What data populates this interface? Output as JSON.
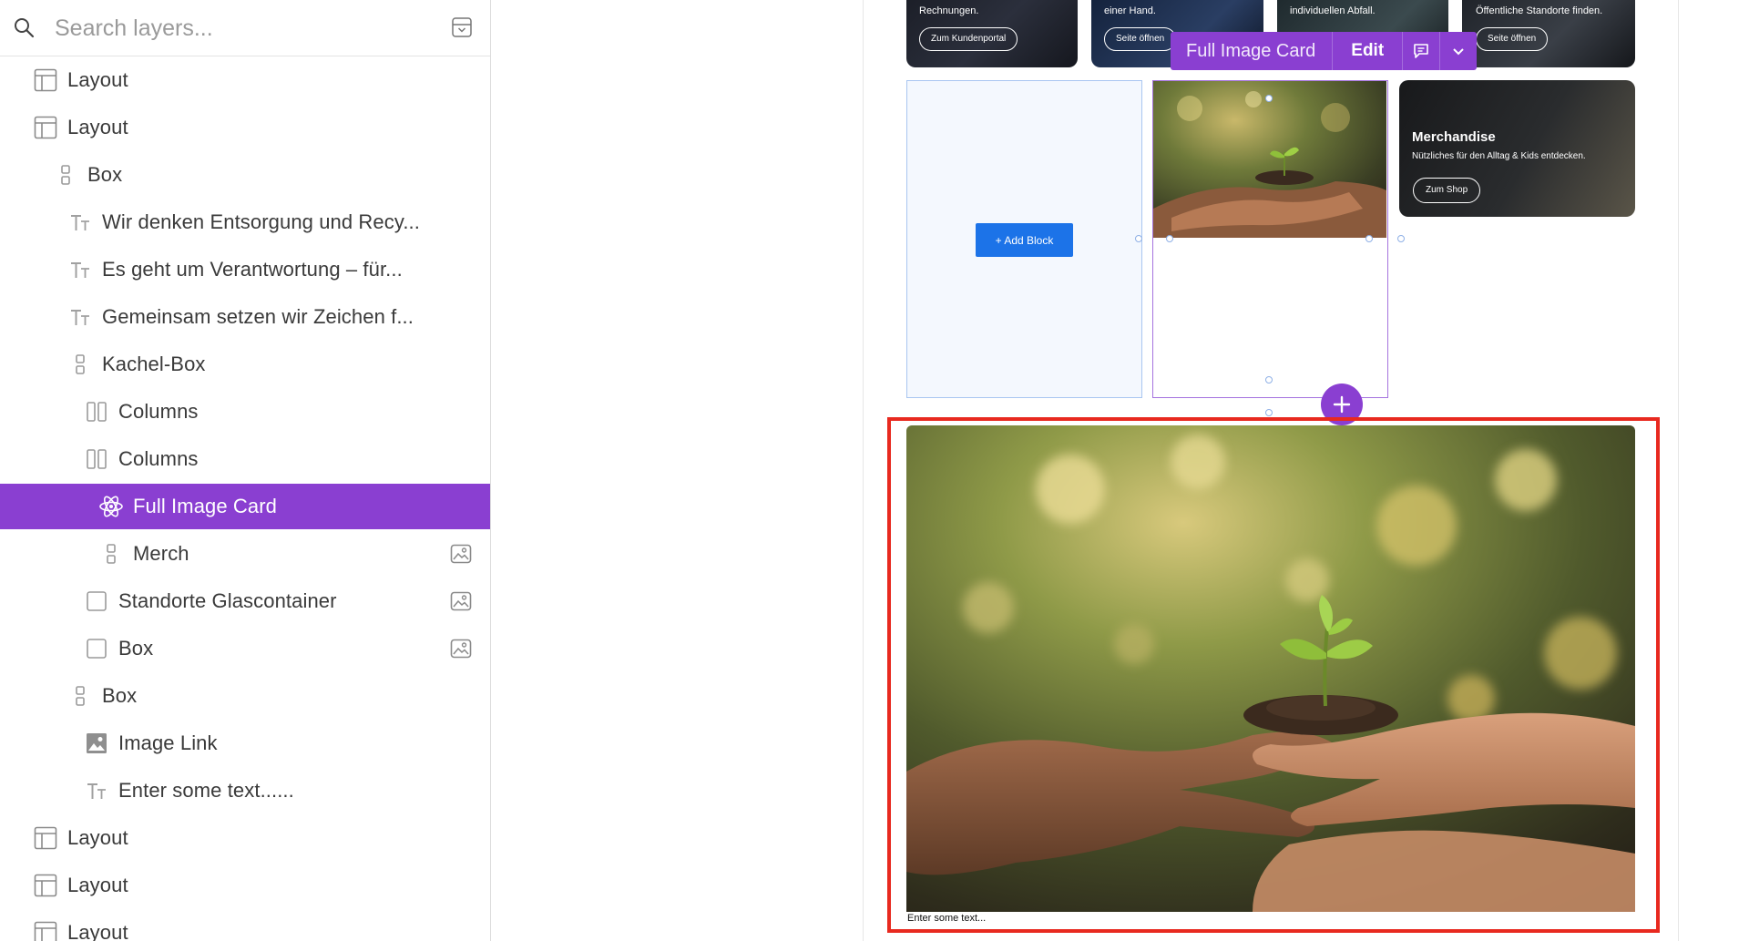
{
  "search": {
    "placeholder": "Search layers..."
  },
  "layers": [
    {
      "label": "Layout",
      "icon": "layout-icon"
    },
    {
      "label": "Layout",
      "icon": "layout-icon"
    },
    {
      "label": "Box",
      "icon": "box-icon"
    },
    {
      "label": "Wir denken Entsorgung und Recy...",
      "icon": "text-icon"
    },
    {
      "label": "Es geht um Verantwortung – für...",
      "icon": "text-icon"
    },
    {
      "label": "Gemeinsam setzen wir Zeichen f...",
      "icon": "text-icon"
    },
    {
      "label": "Kachel-Box",
      "icon": "box-icon"
    },
    {
      "label": "Columns",
      "icon": "columns-icon"
    },
    {
      "label": "Columns",
      "icon": "columns-icon"
    },
    {
      "label": "Full Image Card",
      "icon": "react-component-icon",
      "selected": true
    },
    {
      "label": "Merch",
      "icon": "box-icon",
      "right_icon": "image-icon"
    },
    {
      "label": "Standorte Glascontainer",
      "icon": "checkbox-icon",
      "right_icon": "image-icon"
    },
    {
      "label": "Box",
      "icon": "checkbox-icon",
      "right_icon": "image-icon"
    },
    {
      "label": "Box",
      "icon": "box-icon"
    },
    {
      "label": "Image Link",
      "icon": "image-link-icon"
    },
    {
      "label": "Enter some text......",
      "icon": "text-icon"
    },
    {
      "label": "Layout",
      "icon": "layout-icon"
    },
    {
      "label": "Layout",
      "icon": "layout-icon"
    },
    {
      "label": "Layout",
      "icon": "layout-icon"
    }
  ],
  "canvas": {
    "top_cards": [
      {
        "text": "Rechnungen.",
        "button": "Zum Kundenportal"
      },
      {
        "text": "einer Hand.",
        "button": "Seite öffnen"
      },
      {
        "text": "individuellen Abfall.",
        "button": ""
      },
      {
        "text": "Öffentliche Standorte finden.",
        "button": "Seite öffnen"
      }
    ],
    "toolbar": {
      "title": "Full Image Card",
      "edit_label": "Edit"
    },
    "add_block_label": "+ Add Block",
    "merch": {
      "title": "Merchandise",
      "subtitle": "Nützliches für den Alltag & Kids entdecken.",
      "button": "Zum Shop"
    },
    "caption": "Enter some text..."
  },
  "colors": {
    "accent": "#8a3fd1",
    "highlight": "#e8291f",
    "add_block": "#1c73e8"
  }
}
